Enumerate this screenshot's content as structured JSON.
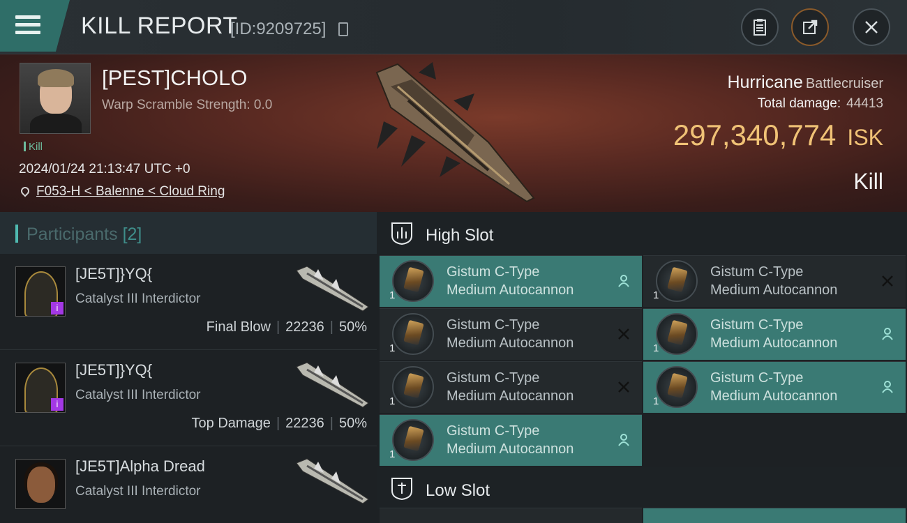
{
  "header": {
    "title": "KILL REPORT",
    "report_id": "[ID:9209725]"
  },
  "victim": {
    "pilot_name": "[PEST]CHOLO",
    "scramble": "Warp Scramble Strength: 0.0",
    "tag": "Kill",
    "datetime": "2024/01/24 21:13:47 UTC +0",
    "location": "F053-H < Balenne < Cloud Ring",
    "ship_name": "Hurricane",
    "ship_class": "Battlecruiser",
    "damage_label": "Total damage:",
    "damage_value": "44413",
    "isk_value": "297,340,774",
    "isk_unit": "ISK",
    "result": "Kill"
  },
  "participants": {
    "label": "Participants",
    "count": "[2]",
    "rows": [
      {
        "name": "[JE5T]}YQ{",
        "ship": "Catalyst III Interdictor",
        "role": "Final Blow",
        "damage": "22236",
        "percent": "50%"
      },
      {
        "name": "[JE5T]}YQ{",
        "ship": "Catalyst III Interdictor",
        "role": "Top Damage",
        "damage": "22236",
        "percent": "50%"
      },
      {
        "name": "[JE5T]Alpha Dread",
        "ship": "Catalyst III Interdictor"
      }
    ]
  },
  "slots": {
    "high_label": "High Slot",
    "low_label": "Low Slot",
    "high_modules": [
      {
        "line1": "Gistum C-Type",
        "line2": "Medium Autocannon",
        "qty": "1",
        "state": "dropped"
      },
      {
        "line1": "Gistum C-Type",
        "line2": "Medium Autocannon",
        "qty": "1",
        "state": "destroyed"
      },
      {
        "line1": "Gistum C-Type",
        "line2": "Medium Autocannon",
        "qty": "1",
        "state": "destroyed"
      },
      {
        "line1": "Gistum C-Type",
        "line2": "Medium Autocannon",
        "qty": "1",
        "state": "dropped"
      },
      {
        "line1": "Gistum C-Type",
        "line2": "Medium Autocannon",
        "qty": "1",
        "state": "destroyed"
      },
      {
        "line1": "Gistum C-Type",
        "line2": "Medium Autocannon",
        "qty": "1",
        "state": "dropped"
      },
      {
        "line1": "Gistum C-Type",
        "line2": "Medium Autocannon",
        "qty": "1",
        "state": "dropped"
      }
    ]
  },
  "colors": {
    "accent_teal": "#3a7a74",
    "isk_gold": "#f0c276",
    "kill_green": "#6dbb9d"
  }
}
